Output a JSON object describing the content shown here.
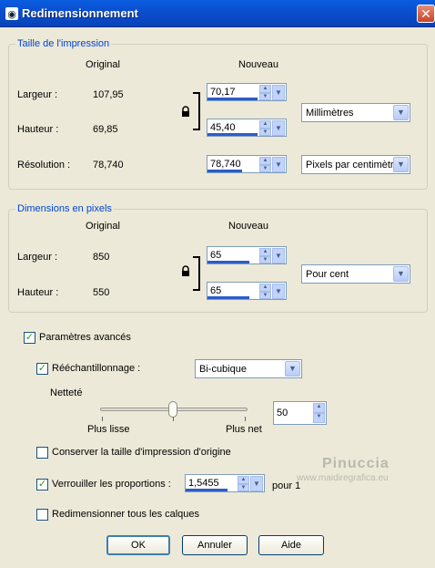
{
  "window": {
    "title": "Redimensionnement",
    "close_glyph": "✕"
  },
  "print_group": {
    "title": "Taille de l'impression",
    "col_original": "Original",
    "col_nouveau": "Nouveau",
    "largeur_label": "Largeur :",
    "largeur_original": "107,95",
    "largeur_value": "70,17",
    "hauteur_label": "Hauteur :",
    "hauteur_original": "69,85",
    "hauteur_value": "45,40",
    "unit_select": "Millimètres",
    "resolution_label": "Résolution :",
    "resolution_original": "78,740",
    "resolution_value": "78,740",
    "resolution_unit_select": "Pixels par centimètre"
  },
  "pixel_group": {
    "title": "Dimensions en pixels",
    "col_original": "Original",
    "col_nouveau": "Nouveau",
    "largeur_label": "Largeur :",
    "largeur_original": "850",
    "largeur_value": "65",
    "hauteur_label": "Hauteur :",
    "hauteur_original": "550",
    "hauteur_value": "65",
    "unit_select": "Pour cent"
  },
  "advanced": {
    "label": "Paramètres avancés",
    "checked": true,
    "resample_label": "Rééchantillonnage :",
    "resample_checked": true,
    "resample_select": "Bi-cubique",
    "sharpness_label": "Netteté",
    "slider_left_label": "Plus lisse",
    "slider_right_label": "Plus net",
    "sharpness_value": "50",
    "keep_print_label": "Conserver la taille d'impression d'origine",
    "keep_print_checked": false,
    "lock_ratio_label": "Verrouiller les proportions :",
    "lock_ratio_checked": true,
    "ratio_value": "1,5455",
    "ratio_suffix": "pour 1",
    "resize_layers_label": "Redimensionner tous les calques",
    "resize_layers_checked": false
  },
  "buttons": {
    "ok": "OK",
    "cancel": "Annuler",
    "help": "Aide"
  },
  "watermark": {
    "name": "Pinuccia",
    "site": "www.maidiregrafica.eu"
  },
  "colors": {
    "titlebar": "#0b4fd0",
    "group_title": "#0046d5",
    "dialog_bg": "#ece9d8",
    "check_green": "#21a121"
  }
}
